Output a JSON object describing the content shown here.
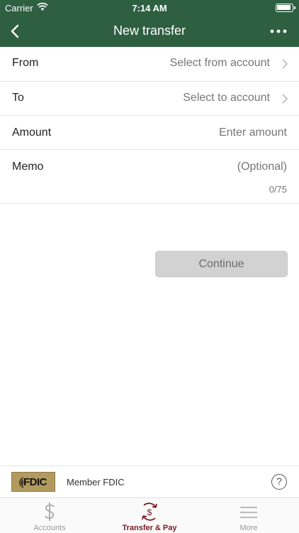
{
  "status_bar": {
    "carrier": "Carrier",
    "time": "7:14 AM"
  },
  "navbar": {
    "title": "New transfer"
  },
  "form": {
    "from": {
      "label": "From",
      "placeholder": "Select from account"
    },
    "to": {
      "label": "To",
      "placeholder": "Select to account"
    },
    "amount": {
      "label": "Amount",
      "placeholder": "Enter amount"
    },
    "memo": {
      "label": "Memo",
      "placeholder": "(Optional)",
      "counter": "0/75"
    }
  },
  "continue_label": "Continue",
  "fdic": {
    "logo_text": "FDIC",
    "label": "Member FDIC",
    "help": "?"
  },
  "tabs": [
    {
      "label": "Accounts",
      "icon": "dollar-icon",
      "active": false
    },
    {
      "label": "Transfer & Pay",
      "icon": "transfer-pay-icon",
      "active": true
    },
    {
      "label": "More",
      "icon": "menu-icon",
      "active": false
    }
  ],
  "colors": {
    "header": "#2e5f41",
    "active_tab": "#7a1a23",
    "fdic_gold": "#b29a5e"
  }
}
